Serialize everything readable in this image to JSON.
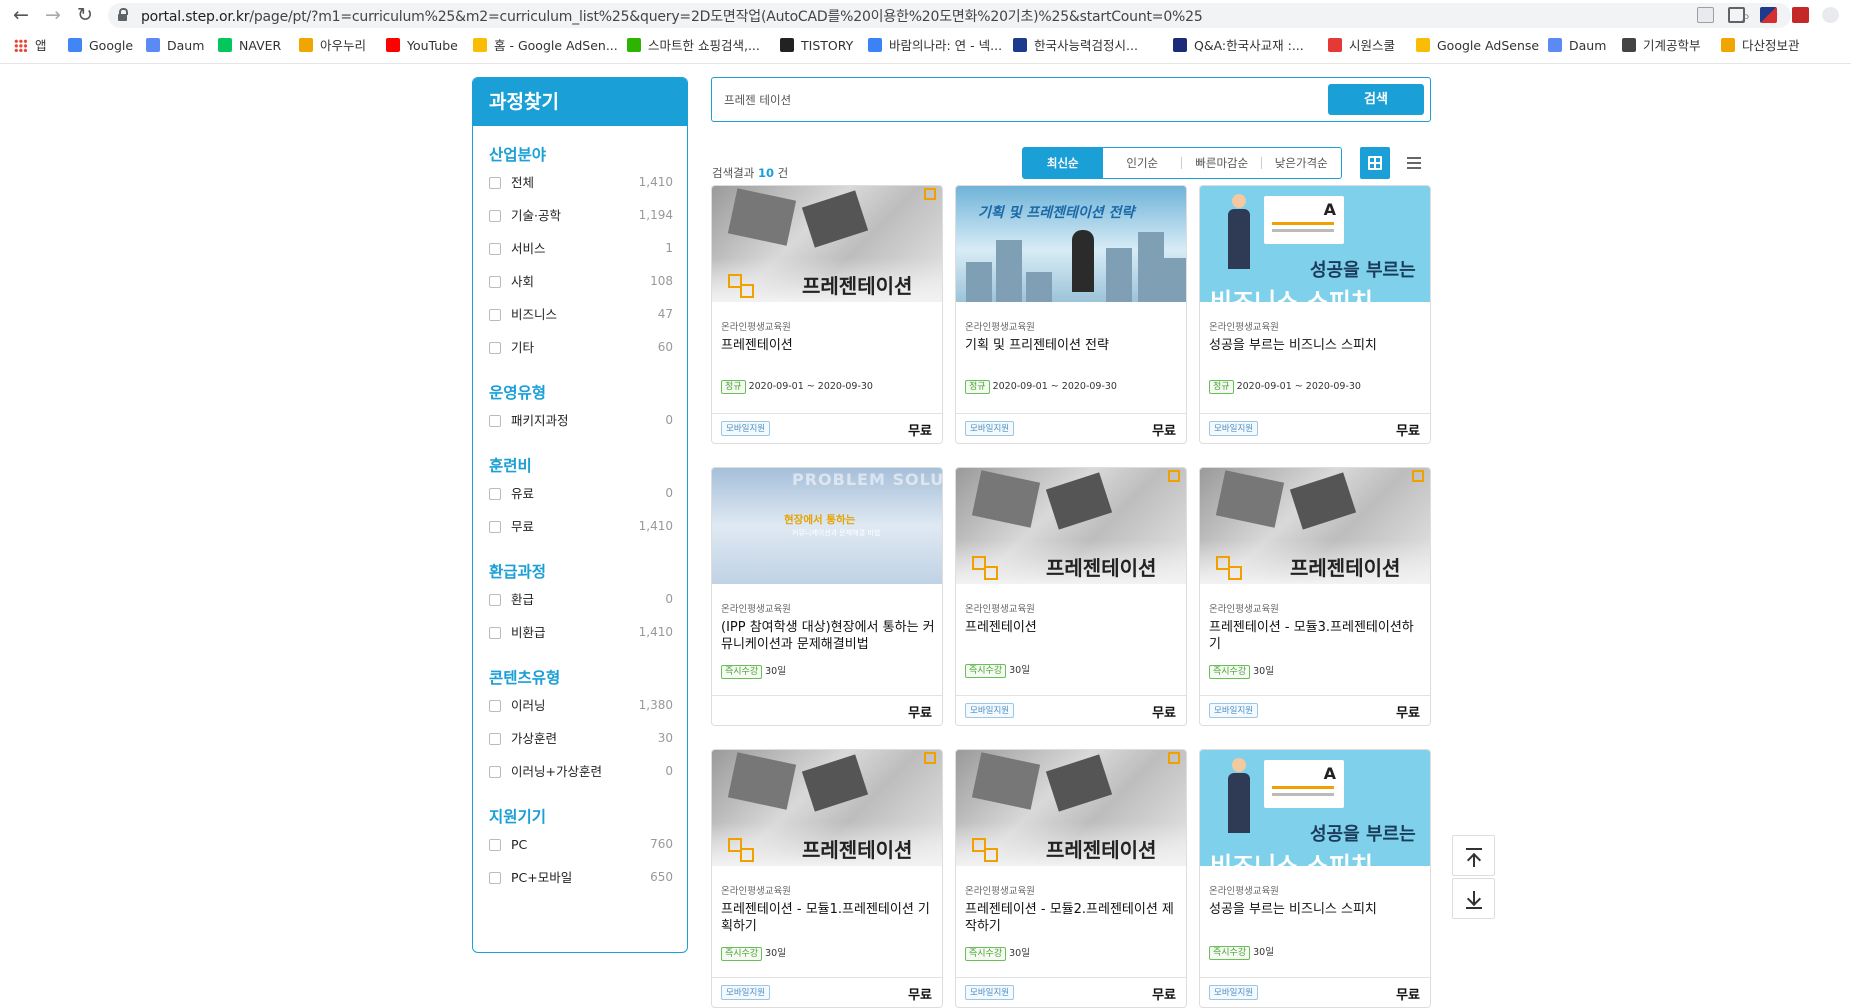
{
  "browser": {
    "url_host": "portal.step.or.kr",
    "url_rest": "/page/pt/?m1=curriculum%25&m2=curriculum_list%25&query=2D도면작업(AutoCAD를%20이용한%20도면화%20기초)%25&startCount=0%25",
    "bookmarks": [
      {
        "label": "앱",
        "icon": "apps-grid-icon",
        "color": "#e84335"
      },
      {
        "label": "Google",
        "icon": "google-icon",
        "color": "#4285f4"
      },
      {
        "label": "Daum",
        "icon": "daum-icon",
        "color": "#5b8af5"
      },
      {
        "label": "NAVER",
        "icon": "naver-icon",
        "color": "#03c75a"
      },
      {
        "label": "아우누리",
        "icon": "auknuri-icon",
        "color": "#f0a500"
      },
      {
        "label": "YouTube",
        "icon": "youtube-icon",
        "color": "#ff0000"
      },
      {
        "label": "홈 - Google AdSen...",
        "icon": "adsense-icon",
        "color": "#fbbc05"
      },
      {
        "label": "스마트한 쇼핑검색,...",
        "icon": "danawa-icon",
        "color": "#2db400"
      },
      {
        "label": "TISTORY",
        "icon": "tistory-icon",
        "color": "#222222"
      },
      {
        "label": "바람의나라: 연 - 넥...",
        "icon": "baram-icon",
        "color": "#3b82f6"
      },
      {
        "label": "한국사능력검정시...",
        "icon": "history-exam-icon",
        "color": "#1b3c8c"
      },
      {
        "label": "Q&A:한국사교재 :...",
        "icon": "hackers-icon",
        "color": "#1a2c78"
      },
      {
        "label": "시원스쿨",
        "icon": "siwon-icon",
        "color": "#e53935"
      },
      {
        "label": "Google AdSense",
        "icon": "adsense-icon",
        "color": "#fbbc05"
      },
      {
        "label": "Daum",
        "icon": "daum-icon",
        "color": "#5b8af5"
      },
      {
        "label": "기계공학부",
        "icon": "globe-icon",
        "color": "#444444"
      },
      {
        "label": "다산정보관",
        "icon": "dasan-icon",
        "color": "#f0a500"
      }
    ]
  },
  "sidebar": {
    "title": "과정찾기",
    "sections": [
      {
        "title": "산업분야",
        "options": [
          {
            "label": "전체",
            "count": "1,410"
          },
          {
            "label": "기술·공학",
            "count": "1,194"
          },
          {
            "label": "서비스",
            "count": "1"
          },
          {
            "label": "사회",
            "count": "108"
          },
          {
            "label": "비즈니스",
            "count": "47"
          },
          {
            "label": "기타",
            "count": "60"
          }
        ]
      },
      {
        "title": "운영유형",
        "options": [
          {
            "label": "패키지과정",
            "count": "0"
          }
        ]
      },
      {
        "title": "훈련비",
        "options": [
          {
            "label": "유료",
            "count": "0"
          },
          {
            "label": "무료",
            "count": "1,410"
          }
        ]
      },
      {
        "title": "환급과정",
        "options": [
          {
            "label": "환급",
            "count": "0"
          },
          {
            "label": "비환급",
            "count": "1,410"
          }
        ]
      },
      {
        "title": "콘텐츠유형",
        "options": [
          {
            "label": "이러닝",
            "count": "1,380"
          },
          {
            "label": "가상훈련",
            "count": "30"
          },
          {
            "label": "이러닝+가상훈련",
            "count": "0"
          }
        ]
      },
      {
        "title": "지원기기",
        "options": [
          {
            "label": "PC",
            "count": "760"
          },
          {
            "label": "PC+모바일",
            "count": "650"
          }
        ]
      }
    ]
  },
  "search": {
    "value": "프레젠 테이션",
    "button": "검색"
  },
  "results": {
    "prefix": "검색결과",
    "count": "10",
    "suffix": "건"
  },
  "sort": {
    "options": [
      "최신순",
      "인기순",
      "빠른마감순",
      "낮은가격순"
    ],
    "active": 0
  },
  "colors": {
    "accent": "#1a9fd6",
    "tag_green": "#4aa034"
  },
  "cards": [
    {
      "org": "온라인평생교육원",
      "title": "프레젠테이션",
      "tag": "정규",
      "meta": "2020-09-01 ~ 2020-09-30",
      "mobile": "모바일지원",
      "price": "무료",
      "thumb": "pres",
      "thumb_text": "프레젠테이션"
    },
    {
      "org": "온라인평생교육원",
      "title": "기획 및 프리젠테이션 전략",
      "tag": "정규",
      "meta": "2020-09-01 ~ 2020-09-30",
      "mobile": "모바일지원",
      "price": "무료",
      "thumb": "plan",
      "thumb_text": "기획 및 프레젠테이션 전략"
    },
    {
      "org": "온라인평생교육원",
      "title": "성공을 부르는 비즈니스 스피치",
      "tag": "정규",
      "meta": "2020-09-01 ~ 2020-09-30",
      "mobile": "모바일지원",
      "price": "무료",
      "thumb": "biz",
      "thumb_text": "성공을 부르는",
      "thumb_text2": "비즈니스 스피치"
    },
    {
      "org": "온라인평생교육원",
      "title": "(IPP 참여학생 대상)현장에서 통하는 커뮤니케이션과 문제해결비법",
      "tag": "즉시수강",
      "meta": "30일",
      "mobile": "",
      "price": "무료",
      "thumb": "ipp",
      "thumb_text": "현장에서 통하는",
      "thumb_sub": "커뮤니케이션과 문제해결 비법",
      "thumb_wm": "PROBLEM SOLUTION"
    },
    {
      "org": "온라인평생교육원",
      "title": "프레젠테이션",
      "tag": "즉시수강",
      "meta": "30일",
      "mobile": "모바일지원",
      "price": "무료",
      "thumb": "pres",
      "thumb_text": "프레젠테이션"
    },
    {
      "org": "온라인평생교육원",
      "title": "프레젠테이션 - 모듈3.프레젠테이션하기",
      "tag": "즉시수강",
      "meta": "30일",
      "mobile": "모바일지원",
      "price": "무료",
      "thumb": "pres",
      "thumb_text": "프레젠테이션"
    },
    {
      "org": "온라인평생교육원",
      "title": "프레젠테이션 - 모듈1.프레젠테이션 기획하기",
      "tag": "즉시수강",
      "meta": "30일",
      "mobile": "모바일지원",
      "price": "무료",
      "thumb": "pres",
      "thumb_text": "프레젠테이션"
    },
    {
      "org": "온라인평생교육원",
      "title": "프레젠테이션 - 모듈2.프레젠테이션 제작하기",
      "tag": "즉시수강",
      "meta": "30일",
      "mobile": "모바일지원",
      "price": "무료",
      "thumb": "pres",
      "thumb_text": "프레젠테이션"
    },
    {
      "org": "온라인평생교육원",
      "title": "성공을 부르는 비즈니스 스피치",
      "tag": "즉시수강",
      "meta": "30일",
      "mobile": "모바일지원",
      "price": "무료",
      "thumb": "biz",
      "thumb_text": "성공을 부르는",
      "thumb_text2": "비즈니스 스피치"
    }
  ]
}
